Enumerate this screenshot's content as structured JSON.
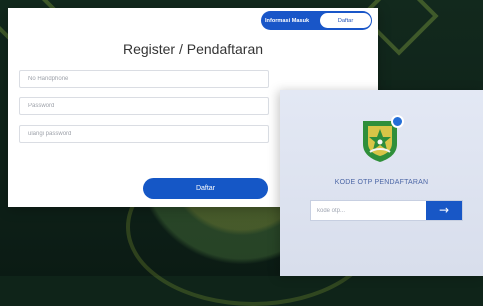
{
  "register_panel": {
    "toggle": {
      "left_label": "Informasi Masuk",
      "right_label": "Daftar"
    },
    "title": "Register / Pendaftaran",
    "fields": {
      "phone_placeholder": "No Handphone",
      "password_placeholder": "Password",
      "repeat_password_placeholder": "ulangi password"
    },
    "submit_label": "Daftar"
  },
  "otp_panel": {
    "title": "KODE OTP PENDAFTARAN",
    "input_placeholder": "kode otp...",
    "submit_icon": "arrow-right-icon"
  },
  "colors": {
    "primary": "#1557c6",
    "background": "#0f2419",
    "otp_panel_bg": "#e3e8f4"
  }
}
